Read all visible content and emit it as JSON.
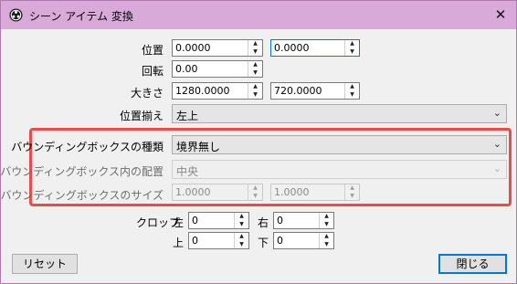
{
  "window": {
    "title": "シーン アイテム 変換",
    "close_glyph": "✕"
  },
  "position": {
    "label": "位置",
    "x": "0.0000",
    "y": "0.0000"
  },
  "rotation": {
    "label": "回転",
    "value": "0.00"
  },
  "size": {
    "label": "大きさ",
    "w": "1280.0000",
    "h": "720.0000"
  },
  "alignment": {
    "label": "位置揃え",
    "value": "左上"
  },
  "bounds_type": {
    "label": "バウンディングボックスの種類",
    "value": "境界無し"
  },
  "bounds_alignment": {
    "label": "バウンディングボックス内の配置",
    "value": "中央"
  },
  "bounds_size": {
    "label": "バウンディングボックスのサイズ",
    "w": "1.0000",
    "h": "1.0000"
  },
  "crop": {
    "label": "クロップ",
    "left_label": "左",
    "left": "0",
    "right_label": "右",
    "right": "0",
    "top_label": "上",
    "top": "0",
    "bottom_label": "下",
    "bottom": "0"
  },
  "buttons": {
    "reset": "リセット",
    "close": "閉じる"
  },
  "glyphs": {
    "up": "▲",
    "down": "▼",
    "chevron": "⌄"
  },
  "colors": {
    "titlebar": "#d9a9d9",
    "highlight": "#ef4a4a",
    "default_button_border": "#0078d7"
  }
}
